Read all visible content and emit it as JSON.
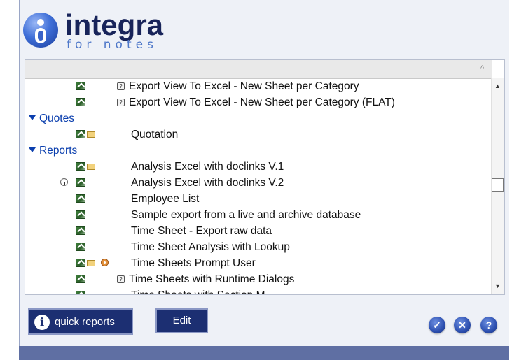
{
  "logo": {
    "main": "integra",
    "sub": "for notes"
  },
  "view": {
    "rows": [
      {
        "type": "item",
        "icons": [
          "excel-icon"
        ],
        "help": true,
        "label": "Export View To Excel - New Sheet per Category"
      },
      {
        "type": "item",
        "icons": [
          "excel-icon"
        ],
        "help": true,
        "label": "Export View To Excel - New Sheet per Category (FLAT)"
      },
      {
        "type": "category",
        "label": "Quotes"
      },
      {
        "type": "item",
        "icons": [
          "excel-icon",
          "envelope-icon"
        ],
        "help": false,
        "label": "Quotation"
      },
      {
        "type": "category",
        "label": "Reports"
      },
      {
        "type": "item",
        "icons": [
          "excel-icon",
          "envelope-icon"
        ],
        "help": false,
        "label": "Analysis Excel with doclinks V.1"
      },
      {
        "type": "item",
        "icons": [
          "clock-icon",
          "excel-icon"
        ],
        "help": false,
        "label": "Analysis Excel with doclinks V.2"
      },
      {
        "type": "item",
        "icons": [
          "excel-icon"
        ],
        "help": false,
        "label": "Employee List"
      },
      {
        "type": "item",
        "icons": [
          "excel-icon"
        ],
        "help": false,
        "label": "Sample export from a live and archive database"
      },
      {
        "type": "item",
        "icons": [
          "excel-icon"
        ],
        "help": false,
        "label": "Time Sheet - Export raw data"
      },
      {
        "type": "item",
        "icons": [
          "excel-icon"
        ],
        "help": false,
        "label": "Time Sheet Analysis with Lookup"
      },
      {
        "type": "item",
        "icons": [
          "excel-icon",
          "envelope-icon",
          "gear-icon"
        ],
        "help": false,
        "label": "Time Sheets Prompt User"
      },
      {
        "type": "item",
        "icons": [
          "excel-icon"
        ],
        "help": true,
        "label": "Time Sheets with Runtime Dialogs"
      },
      {
        "type": "item",
        "icons": [
          "excel-icon"
        ],
        "help": false,
        "label": "Time Sheets with Section M..."
      }
    ]
  },
  "buttons": {
    "quick_reports": "quick reports",
    "edit": "Edit",
    "ok_glyph": "✓",
    "cancel_glyph": "✕",
    "help_glyph": "?"
  },
  "colors": {
    "category": "#0b3fae",
    "button_bg": "#1c2f72",
    "frame_bottom": "#5f6fa3"
  }
}
